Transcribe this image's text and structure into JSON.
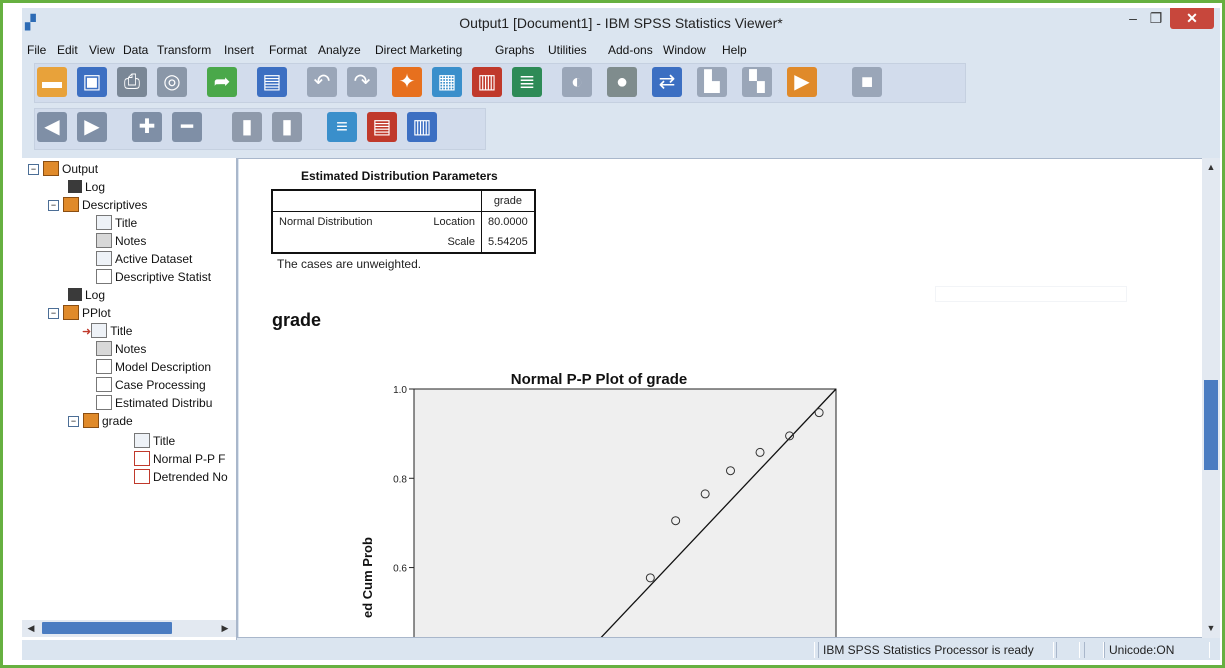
{
  "window": {
    "title": "Output1 [Document1] - IBM SPSS Statistics Viewer*",
    "min_glyph": "–",
    "max_glyph": "❐",
    "close_glyph": "✕"
  },
  "menu": [
    "File",
    "Edit",
    "View",
    "Data",
    "Transform",
    "Insert",
    "Format",
    "Analyze",
    "Direct Marketing",
    "Graphs",
    "Utilities",
    "Add-ons",
    "Window",
    "Help"
  ],
  "toolbar1": [
    {
      "name": "open-icon",
      "glyph": "▬",
      "color": "#e8a23a"
    },
    {
      "name": "save-icon",
      "glyph": "▣",
      "color": "#3c6fc2"
    },
    {
      "name": "print-icon",
      "glyph": "⎙",
      "color": "#7a8796"
    },
    {
      "name": "print-preview-icon",
      "glyph": "◎",
      "color": "#8a97a8"
    },
    {
      "name": "export-icon",
      "glyph": "➦",
      "color": "#4aa84a"
    },
    {
      "name": "recall-dialog-icon",
      "glyph": "▤",
      "color": "#3c6fc2"
    },
    {
      "name": "undo-icon",
      "glyph": "↶",
      "color": "#9aa6b8"
    },
    {
      "name": "redo-icon",
      "glyph": "↷",
      "color": "#9aa6b8"
    },
    {
      "name": "goto-case-icon",
      "glyph": "✦",
      "color": "#e7701e"
    },
    {
      "name": "goto-variable-icon",
      "glyph": "▦",
      "color": "#3a8fcb"
    },
    {
      "name": "variables-icon",
      "glyph": "▥",
      "color": "#c0392b"
    },
    {
      "name": "designate-window-icon",
      "glyph": "≣",
      "color": "#2e8b57"
    },
    {
      "name": "select-cases-icon",
      "glyph": "◐",
      "color": "#9aa6b8"
    },
    {
      "name": "value-labels-icon",
      "glyph": "●",
      "color": "#7f8c8d"
    },
    {
      "name": "use-sets-icon",
      "glyph": "⇄",
      "color": "#3c6fc2"
    },
    {
      "name": "show-all-icon",
      "glyph": "▙",
      "color": "#9aa6b8"
    },
    {
      "name": "spell-icon",
      "glyph": "▚",
      "color": "#9aa6b8"
    },
    {
      "name": "run-script-icon",
      "glyph": "▶",
      "color": "#e08a2a"
    },
    {
      "name": "stop-icon",
      "glyph": "■",
      "color": "#9aa6b8"
    }
  ],
  "toolbar2": [
    {
      "name": "promote-icon",
      "glyph": "◀",
      "color": "#7f8fa6"
    },
    {
      "name": "demote-icon",
      "glyph": "▶",
      "color": "#7f8fa6"
    },
    {
      "name": "expand-icon",
      "glyph": "✚",
      "color": "#7f8fa6"
    },
    {
      "name": "collapse-icon",
      "glyph": "━",
      "color": "#7f8fa6"
    },
    {
      "name": "show-icon",
      "glyph": "▮",
      "color": "#8f9aab"
    },
    {
      "name": "hide-icon",
      "glyph": "▮",
      "color": "#8f9aab"
    },
    {
      "name": "insert-heading-icon",
      "glyph": "≡",
      "color": "#3a8fcb"
    },
    {
      "name": "insert-title-icon",
      "glyph": "▤",
      "color": "#c0392b"
    },
    {
      "name": "insert-text-icon",
      "glyph": "▥",
      "color": "#3c6fc2"
    }
  ],
  "tree": {
    "output": "Output",
    "log1": "Log",
    "descriptives": "Descriptives",
    "desc_title": "Title",
    "desc_notes": "Notes",
    "active_dataset": "Active Dataset",
    "descriptive_stats": "Descriptive Statist",
    "log2": "Log",
    "pplot": "PPlot",
    "pplot_title": "Title",
    "pplot_notes": "Notes",
    "model_description": "Model Description",
    "case_processing": "Case Processing",
    "estimated_distrib": "Estimated Distribu",
    "grade": "grade",
    "grade_title": "Title",
    "normal_pp": "Normal P-P F",
    "detrended": "Detrended No",
    "expanded_glyph": "−"
  },
  "content": {
    "table_title": "Estimated Distribution Parameters",
    "col_header": "grade",
    "row_group": "Normal Distribution",
    "row1_label": "Location",
    "row1_value": "80.0000",
    "row2_label": "Scale",
    "row2_value": "5.54205",
    "footnote": "The cases are unweighted.",
    "heading": "grade"
  },
  "chart_data": {
    "type": "scatter",
    "title": "Normal P-P Plot of grade",
    "ylabel": "ed Cum Prob",
    "yticks": [
      "1.0",
      "0.8",
      "0.6"
    ],
    "ylim_visible": [
      0.44,
      1.0
    ],
    "xlim": [
      0.0,
      1.0
    ],
    "reference_line": "y=x",
    "points": [
      {
        "x": 0.56,
        "y": 0.577
      },
      {
        "x": 0.62,
        "y": 0.705
      },
      {
        "x": 0.69,
        "y": 0.765
      },
      {
        "x": 0.75,
        "y": 0.817
      },
      {
        "x": 0.82,
        "y": 0.858
      },
      {
        "x": 0.89,
        "y": 0.895
      },
      {
        "x": 0.96,
        "y": 0.947
      }
    ]
  },
  "status": {
    "processor": "IBM SPSS Statistics Processor is ready",
    "unicode": "Unicode:ON"
  },
  "scroll_arrows": {
    "left": "◀",
    "right": "▶",
    "up": "▲",
    "down": "▼"
  },
  "colors": {
    "frame": "#66b040",
    "window": "#dbe5f0",
    "scroll_thumb": "#4a7cc1",
    "close": "#c7473c",
    "plot_bg": "#efefef"
  }
}
